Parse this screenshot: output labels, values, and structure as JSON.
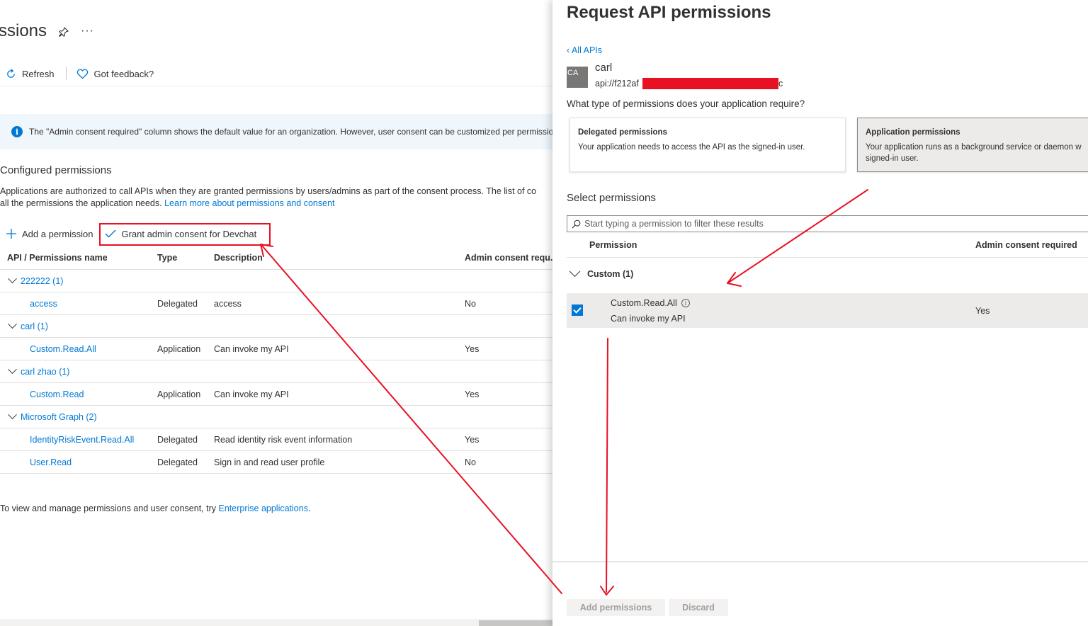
{
  "page": {
    "title": "ssions",
    "more": "···"
  },
  "toolbar": {
    "refresh_label": "Refresh",
    "feedback_label": "Got feedback?"
  },
  "info_bar": {
    "icon": "i",
    "text": "The \"Admin consent required\" column shows the default value for an organization. However, user consent can be customized per permission"
  },
  "configured": {
    "title": "Configured permissions",
    "desc_line1": "Applications are authorized to call APIs when they are granted permissions by users/admins as part of the consent process. The list of co",
    "desc_line2_prefix": "all the permissions the application needs. ",
    "desc_link": "Learn more about permissions and consent"
  },
  "commands": {
    "add_permission": "Add a permission",
    "grant_consent": "Grant admin consent for Devchat"
  },
  "table": {
    "headers": [
      "API / Permissions name",
      "Type",
      "Description",
      "Admin consent requ..."
    ],
    "groups": [
      {
        "name": "222222 (1)",
        "rows": [
          {
            "name": "access",
            "type": "Delegated",
            "desc": "access",
            "admin": "No"
          }
        ]
      },
      {
        "name": "carl (1)",
        "rows": [
          {
            "name": "Custom.Read.All",
            "type": "Application",
            "desc": "Can invoke my API",
            "admin": "Yes"
          }
        ]
      },
      {
        "name": "carl zhao (1)",
        "rows": [
          {
            "name": "Custom.Read",
            "type": "Application",
            "desc": "Can invoke my API",
            "admin": "Yes"
          }
        ]
      },
      {
        "name": "Microsoft Graph (2)",
        "rows": [
          {
            "name": "IdentityRiskEvent.Read.All",
            "type": "Delegated",
            "desc": "Read identity risk event information",
            "admin": "Yes"
          },
          {
            "name": "User.Read",
            "type": "Delegated",
            "desc": "Sign in and read user profile",
            "admin": "No"
          }
        ]
      }
    ]
  },
  "footer_note": {
    "prefix": "To view and manage permissions and user consent, try ",
    "link": "Enterprise applications",
    "suffix": "."
  },
  "panel": {
    "title": "Request API permissions",
    "back_link": "All APIs",
    "avatar_initials": "CA",
    "api_name": "carl",
    "api_uri_prefix": "api://f212af",
    "api_uri_suffix": "c",
    "question": "What type of permissions does your application require?",
    "delegated_card": {
      "title": "Delegated permissions",
      "desc": "Your application needs to access the API as the signed-in user."
    },
    "application_card": {
      "title": "Application permissions",
      "desc": "Your application runs as a background service or daemon w signed-in user."
    },
    "select_title": "Select permissions",
    "filter_placeholder": "Start typing a permission to filter these results",
    "col_permission": "Permission",
    "col_admin": "Admin consent required",
    "group_name": "Custom (1)",
    "perm": {
      "name": "Custom.Read.All",
      "desc": "Can invoke my API",
      "admin": "Yes",
      "checked": true
    },
    "add_button": "Add permissions",
    "discard_button": "Discard"
  },
  "colors": {
    "accent": "#0078d4",
    "annotation": "#e81123"
  }
}
